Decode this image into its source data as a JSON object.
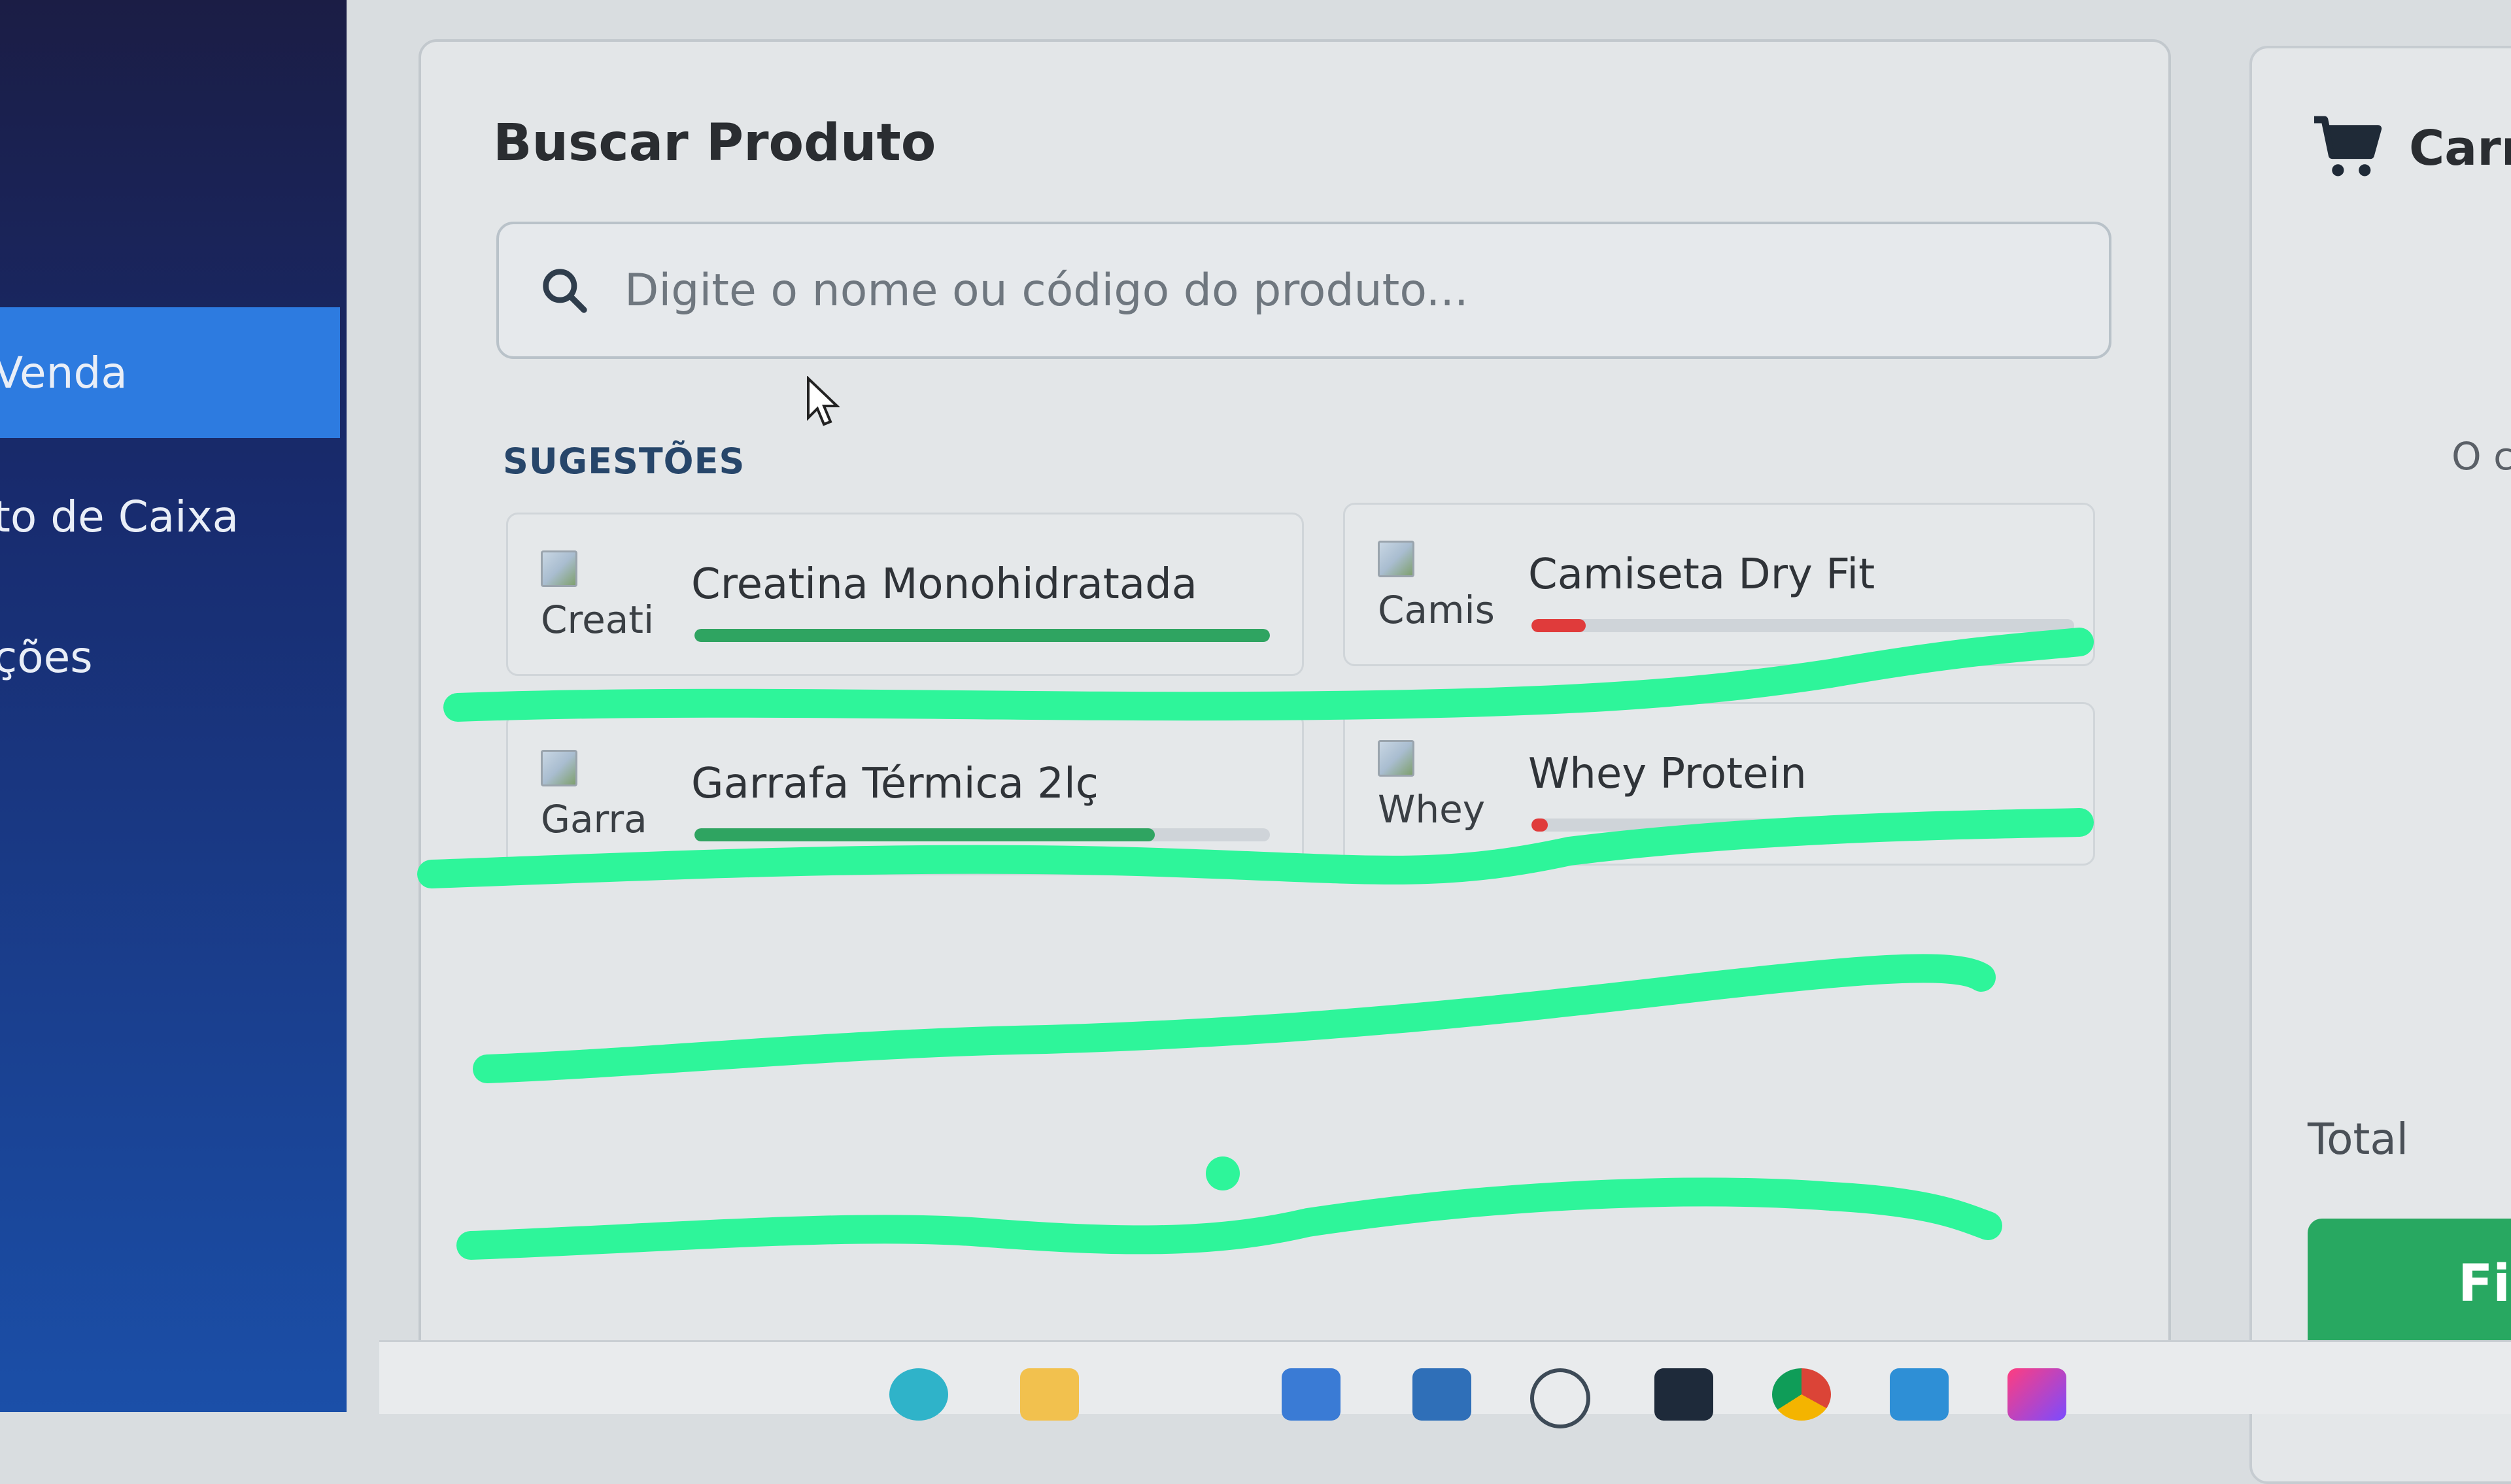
{
  "sidebar": {
    "items": [
      {
        "label": "Venda",
        "active": true
      },
      {
        "label": "to de Caixa",
        "active": false
      },
      {
        "label": "ções",
        "active": false
      }
    ]
  },
  "search": {
    "title": "Buscar Produto",
    "placeholder": "Digite o nome ou código do produto...",
    "icon": "search-icon"
  },
  "suggestions": {
    "label": "SUGESTÕES",
    "items": [
      {
        "name": "Creatina Monohidratada",
        "alt": "Creati",
        "stock_fraction": 1.0,
        "stock_color": "#2fa461"
      },
      {
        "name": "Camiseta Dry Fit",
        "alt": "Camis",
        "stock_fraction": 0.1,
        "stock_color": "#e03b3b"
      },
      {
        "name": "Garrafa Térmica 2lç",
        "alt": "Garra",
        "stock_fraction": 0.8,
        "stock_color": "#2fa461"
      },
      {
        "name": "Whey Protein",
        "alt": "Whey",
        "stock_fraction": 0.03,
        "stock_color": "#e03b3b"
      }
    ]
  },
  "cart": {
    "title": "Carri",
    "empty_text": "O c",
    "total_label": "Total",
    "finish_label": "Fi",
    "icon": "cart-icon"
  },
  "taskbar": {
    "icons": [
      "edge-icon",
      "file-explorer-icon",
      "store-icon",
      "briefcase-icon",
      "whatsapp-icon",
      "pycharm-icon",
      "chrome-icon",
      "vscode-icon",
      "intellij-icon"
    ]
  },
  "colors": {
    "accent": "#2d7be0",
    "stock_ok": "#2fa461",
    "stock_low": "#e03b3b",
    "annotation": "#2ef59a",
    "finish_button": "#28a861"
  }
}
